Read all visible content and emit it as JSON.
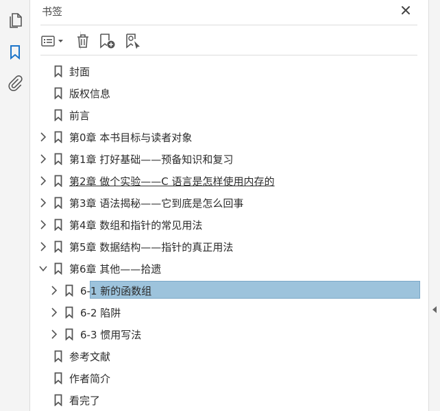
{
  "panel": {
    "title": "书签",
    "colors": {
      "selected_bg": "#9dc3dc",
      "icon": "#555555"
    }
  },
  "left_rail": {
    "items": [
      {
        "name": "pages-icon"
      },
      {
        "name": "bookmark-icon",
        "active": true
      },
      {
        "name": "attachment-icon"
      }
    ]
  },
  "toolbar": {
    "buttons": [
      {
        "name": "options-menu-button",
        "icon": "list-options-icon"
      },
      {
        "name": "delete-bookmark-button",
        "icon": "trash-icon"
      },
      {
        "name": "new-bookmark-button",
        "icon": "bookmark-add-icon"
      },
      {
        "name": "find-current-bookmark-button",
        "icon": "bookmark-search-icon"
      }
    ]
  },
  "bookmarks": [
    {
      "label": "封面",
      "level": 0,
      "expandable": false
    },
    {
      "label": "版权信息",
      "level": 0,
      "expandable": false
    },
    {
      "label": "前言",
      "level": 0,
      "expandable": false
    },
    {
      "label": "第0章 本书目标与读者对象",
      "level": 0,
      "expandable": true,
      "expanded": false
    },
    {
      "label": "第1章 打好基础——预备知识和复习",
      "level": 0,
      "expandable": true,
      "expanded": false
    },
    {
      "label": "第2章 做个实验——C 语言是怎样使用内存的",
      "level": 0,
      "expandable": true,
      "expanded": false,
      "underlined": true
    },
    {
      "label": "第3章 语法揭秘——它到底是怎么回事",
      "level": 0,
      "expandable": true,
      "expanded": false
    },
    {
      "label": "第4章 数组和指针的常见用法",
      "level": 0,
      "expandable": true,
      "expanded": false
    },
    {
      "label": "第5章 数据结构——指针的真正用法",
      "level": 0,
      "expandable": true,
      "expanded": false
    },
    {
      "label": "第6章 其他——拾遗",
      "level": 0,
      "expandable": true,
      "expanded": true
    },
    {
      "label": "6-1 新的函数组",
      "level": 1,
      "expandable": true,
      "expanded": false,
      "selected": true
    },
    {
      "label": "6-2 陷阱",
      "level": 1,
      "expandable": true,
      "expanded": false
    },
    {
      "label": "6-3 惯用写法",
      "level": 1,
      "expandable": true,
      "expanded": false
    },
    {
      "label": "参考文献",
      "level": 0,
      "expandable": false
    },
    {
      "label": "作者简介",
      "level": 0,
      "expandable": false
    },
    {
      "label": "看完了",
      "level": 0,
      "expandable": false
    }
  ]
}
